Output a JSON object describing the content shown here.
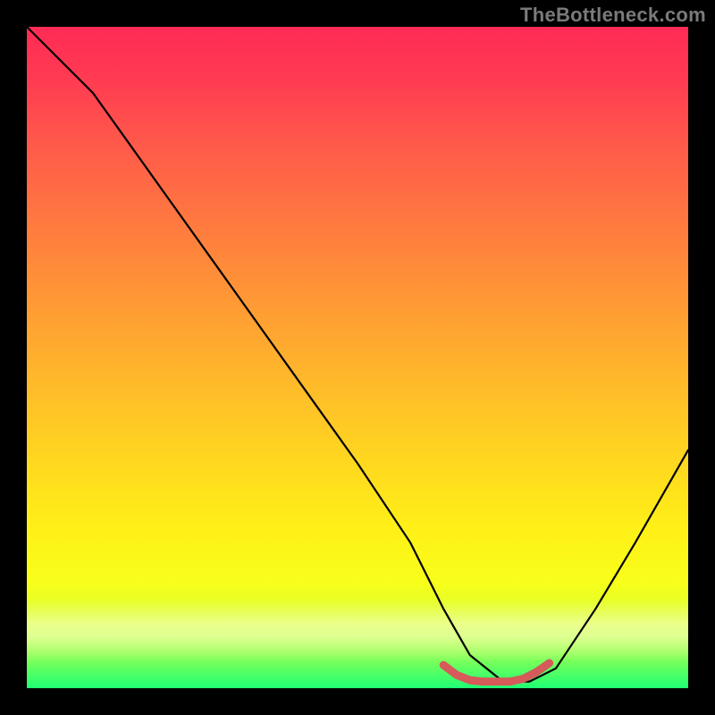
{
  "watermark": "TheBottleneck.com",
  "chart_data": {
    "type": "line",
    "title": "",
    "xlabel": "",
    "ylabel": "",
    "xlim": [
      0,
      100
    ],
    "ylim": [
      0,
      100
    ],
    "grid": false,
    "legend": false,
    "background_gradient": {
      "top": "#ff2b55",
      "mid": "#ffd81f",
      "bottom": "#1eff73"
    },
    "series": [
      {
        "name": "bottleneck-curve",
        "color": "#000000",
        "x": [
          0,
          4,
          10,
          20,
          30,
          40,
          50,
          58,
          63,
          67,
          72,
          76,
          80,
          86,
          92,
          100
        ],
        "y": [
          100,
          96,
          90,
          76,
          62,
          48,
          34,
          22,
          12,
          5,
          1,
          1,
          3,
          12,
          22,
          36
        ]
      },
      {
        "name": "optimal-range-marker",
        "color": "#d65a5a",
        "x": [
          63,
          65,
          67,
          69,
          71,
          73,
          75,
          77,
          79
        ],
        "y": [
          3.5,
          2.0,
          1.2,
          1.0,
          1.0,
          1.0,
          1.4,
          2.4,
          3.8
        ]
      }
    ],
    "annotations": []
  }
}
